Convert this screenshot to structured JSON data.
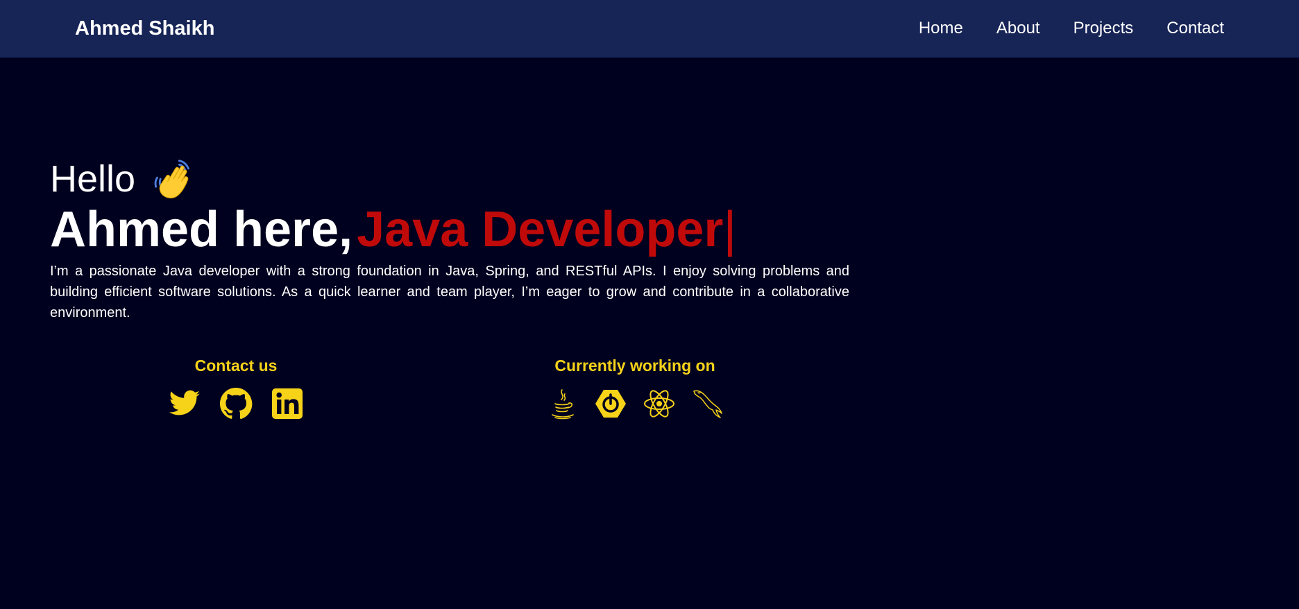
{
  "nav": {
    "brand": "Ahmed Shaikh",
    "links": [
      "Home",
      "About",
      "Projects",
      "Contact"
    ]
  },
  "hero": {
    "greeting": "Hello",
    "wave_icon": "waving-hand-icon",
    "name": "Ahmed here,",
    "role": "Java Developer",
    "cursor": "|",
    "bio": "I’m a passionate Java developer with a strong foundation in Java, Spring, and RESTful APIs. I enjoy solving problems and building efficient software solutions. As a quick learner and team player, I’m eager to grow and contribute in a collaborative environment."
  },
  "contact": {
    "title": "Contact us",
    "icons": [
      "twitter-icon",
      "github-icon",
      "linkedin-icon"
    ]
  },
  "working_on": {
    "title": "Currently working on",
    "icons": [
      "java-icon",
      "spring-boot-icon",
      "react-icon",
      "mysql-icon"
    ]
  },
  "colors": {
    "background": "#00001f",
    "navbar": "#172456",
    "accent_yellow": "#f6d219",
    "role_red": "#c00a0a",
    "text": "#ffffff"
  }
}
